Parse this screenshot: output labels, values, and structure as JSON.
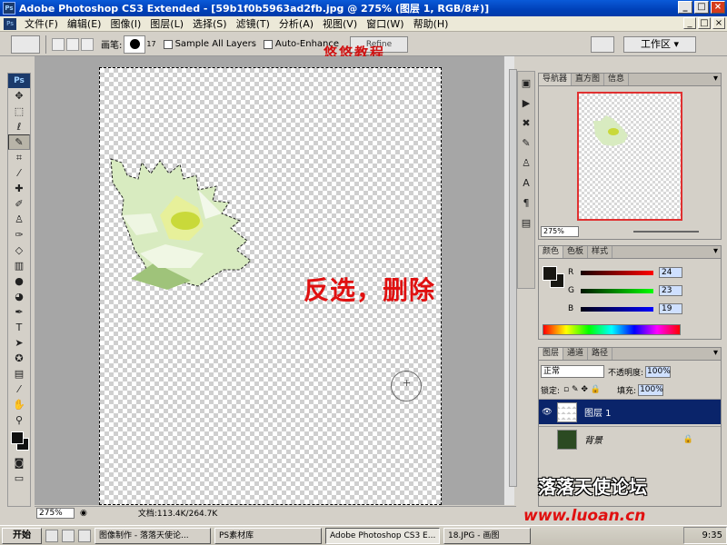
{
  "window": {
    "title": "Adobe Photoshop CS3 Extended - [59b1f0b5963ad2fb.jpg @ 275% (图层 1, RGB/8#)]",
    "app_icon": "Ps"
  },
  "menu": [
    "文件(F)",
    "编辑(E)",
    "图像(I)",
    "图层(L)",
    "选择(S)",
    "滤镜(T)",
    "分析(A)",
    "视图(V)",
    "窗口(W)",
    "帮助(H)"
  ],
  "options": {
    "brush_label": "画笔:",
    "brush_size": "17",
    "sample_all_layers": "Sample All Layers",
    "auto_enhance": "Auto-Enhance",
    "refine_edge": "Refine Edge...",
    "workspace": "工作区 ▾"
  },
  "overlay_title": "悠悠教程",
  "annotation": "反选，删除",
  "status": {
    "zoom": "275%",
    "doc_info": "文档:113.4K/264.7K"
  },
  "navigator": {
    "tabs": [
      "导航器",
      "直方图",
      "信息"
    ],
    "zoom": "275%"
  },
  "color_panel": {
    "tabs": [
      "颜色",
      "色板",
      "样式"
    ],
    "r_label": "R",
    "g_label": "G",
    "b_label": "B",
    "r": "24",
    "g": "23",
    "b": "19",
    "foreground": "#181713"
  },
  "layers_panel": {
    "tabs": [
      "图层",
      "通道",
      "路径"
    ],
    "blend_mode": "正常",
    "opacity_label": "不透明度:",
    "opacity": "100%",
    "lock_label": "锁定:",
    "fill_label": "填充:",
    "fill": "100%",
    "layers": [
      {
        "name": "图层 1",
        "selected": true
      },
      {
        "name": "背景",
        "selected": false
      }
    ]
  },
  "watermark": "落落天使论坛",
  "url": "www.luoan.cn",
  "taskbar": {
    "start": "开始",
    "items": [
      "图像制作 - 落落天使论...",
      "PS素材库",
      "Adobe Photoshop CS3 E...",
      "18.JPG - 画图"
    ],
    "active_index": 2,
    "clock": "9:35"
  },
  "colors": {
    "title_blue": "#0040b8",
    "annotation_red": "#e01010",
    "layer_selected": "#0a246a"
  }
}
